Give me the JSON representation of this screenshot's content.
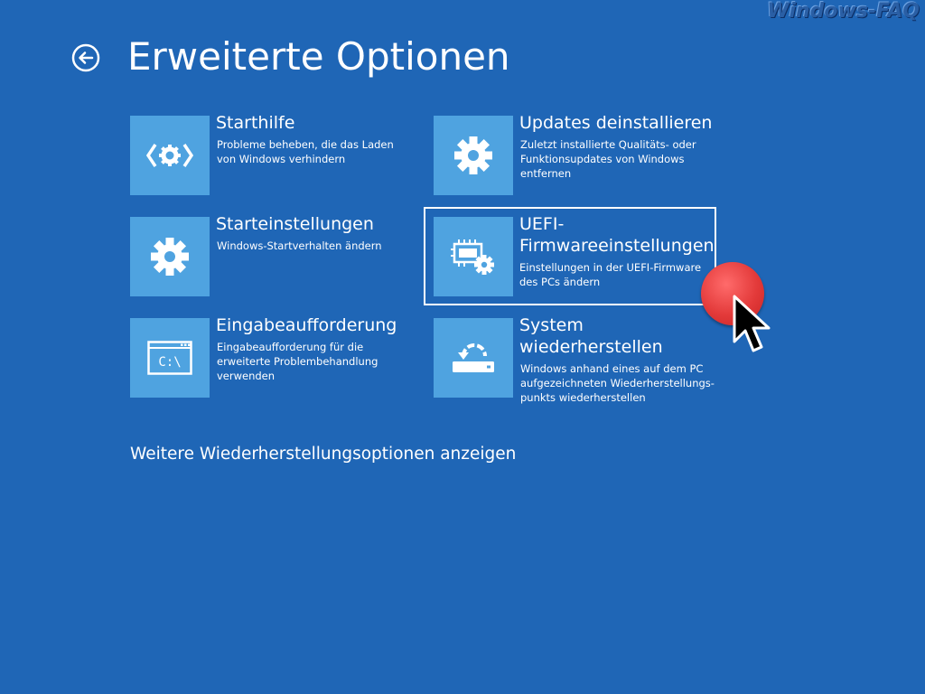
{
  "watermark": "Windows-FAQ",
  "header": {
    "title": "Erweiterte Optionen",
    "back_icon": "back-arrow-circle-icon"
  },
  "tiles": [
    {
      "title": "Starthilfe",
      "description": "Probleme beheben, die das Laden von Windows verhindern",
      "icon": "startup-repair-icon"
    },
    {
      "title": "Updates deinstallieren",
      "description": "Zuletzt installierte Qualitäts- oder Funktionsupdates von Windows entfernen",
      "icon": "gear-icon"
    },
    {
      "title": "Starteinstellungen",
      "description": "Windows-Startverhalten ändern",
      "icon": "gear-icon"
    },
    {
      "title": "UEFI-Firmwareeinstellungen",
      "title_line1": "UEFI-",
      "title_line2": "Firmwareeinstellungen",
      "description": "Einstellungen in der UEFI-Firmware des PCs ändern",
      "icon": "firmware-chip-gear-icon",
      "focused": true
    },
    {
      "title": "Eingabeaufforderung",
      "description": "Eingabeaufforderung für die erweiterte Problembehandlung verwenden",
      "icon": "command-prompt-icon",
      "icon_text": "C:\\"
    },
    {
      "title": "System wiederherstellen",
      "title_line1": "System",
      "title_line2": "wiederherstellen",
      "description": "Windows anhand eines auf dem PC aufgezeichneten Wiederherstellungs-punkts wiederherstellen",
      "icon": "system-restore-icon"
    }
  ],
  "more_link": "Weitere Wiederherstellungsoptionen anzeigen",
  "colors": {
    "background": "#1f66b6",
    "tile_icon_bg": "#4fa3e0",
    "text": "#ffffff",
    "click_indicator": "#e33a3a"
  }
}
